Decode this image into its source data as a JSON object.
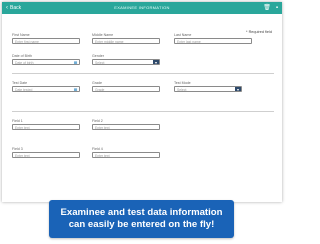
{
  "header": {
    "back_label": "Back",
    "title": "EXAMINEE INFORMATION",
    "icons": [
      "trash-icon",
      "save-icon"
    ]
  },
  "required_note": "* Required field",
  "fields": {
    "first_name": {
      "label": "First Name",
      "placeholder": "Enter first name"
    },
    "middle_name": {
      "label": "Middle Name",
      "placeholder": "Enter middle name"
    },
    "last_name": {
      "label": "Last Name",
      "placeholder": "Enter last name"
    },
    "dob": {
      "label": "Date of Birth",
      "value": "Date of birth"
    },
    "gender": {
      "label": "Gender",
      "value": "Select"
    },
    "test_date": {
      "label": "Test Date",
      "value": "Date tested"
    },
    "grade": {
      "label": "Grade",
      "value": "Grade"
    },
    "test_mode": {
      "label": "Test Mode",
      "value": "Select"
    },
    "field1": {
      "label": "Field 1",
      "placeholder": "Enter text"
    },
    "field2": {
      "label": "Field 2",
      "placeholder": "Enter text"
    },
    "field3": {
      "label": "Field 3",
      "placeholder": "Enter text"
    },
    "field4": {
      "label": "Field 4",
      "placeholder": "Enter text"
    }
  },
  "callout": {
    "line1": "Examinee and test data information",
    "line2": "can easily be entered on the fly!"
  },
  "colors": {
    "header": "#2aa79b",
    "dropdown": "#2f4a6b",
    "callout": "#1a63b7"
  }
}
